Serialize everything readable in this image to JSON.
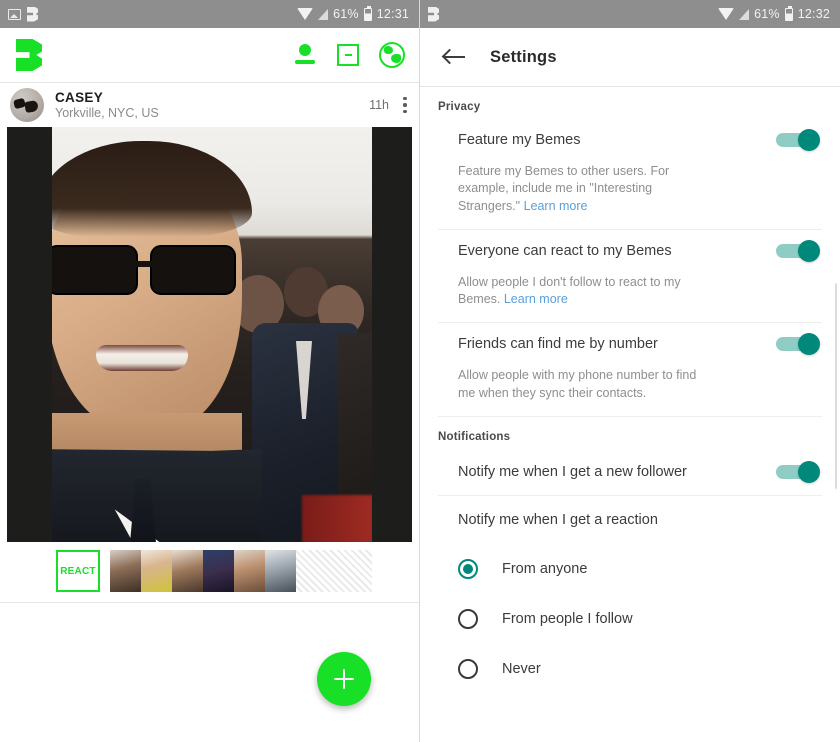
{
  "left": {
    "status_bar": {
      "icons": [
        "screenshot-icon",
        "beme-app-icon"
      ],
      "wifi_icon": "wifi-icon",
      "signal_icon": "cell-signal-icon",
      "battery_text": "61%",
      "battery_icon": "battery-icon",
      "time": "12:31"
    },
    "app_bar": {
      "logo": "beme-logo",
      "actions": [
        {
          "name": "profile-icon"
        },
        {
          "name": "square-dash-icon"
        },
        {
          "name": "globe-icon"
        }
      ]
    },
    "post": {
      "author": "CASEY",
      "location": "Yorkville, NYC, US",
      "time_ago": "11h",
      "menu_icon": "overflow-menu-icon",
      "avatar_icon": "sunglasses-avatar"
    },
    "react": {
      "button_label": "REACT",
      "thumb_count": 6
    },
    "fab": {
      "label": "+",
      "color": "#17e027"
    }
  },
  "right": {
    "status_bar": {
      "icons": [
        "beme-app-icon"
      ],
      "wifi_icon": "wifi-icon",
      "signal_icon": "cell-signal-icon",
      "battery_text": "61%",
      "battery_icon": "battery-icon",
      "time": "12:32"
    },
    "app_bar": {
      "back_icon": "back-arrow-icon",
      "title": "Settings"
    },
    "sections": [
      {
        "label": "Privacy",
        "items": [
          {
            "title": "Feature my Bemes",
            "desc": "Feature my Bemes to other users. For example, include me in \"Interesting Strangers.\" ",
            "link": "Learn more",
            "toggle": "on"
          },
          {
            "title": "Everyone can react to my Bemes",
            "desc": "Allow people I don't follow to react to my Bemes. ",
            "link": "Learn more",
            "toggle": "on"
          },
          {
            "title": "Friends can find me by number",
            "desc": "Allow people with my phone number to find me when they sync their contacts.",
            "link": "",
            "toggle": "on"
          }
        ]
      },
      {
        "label": "Notifications",
        "items": [
          {
            "title": "Notify me when I get a new follower",
            "desc": "",
            "link": "",
            "toggle": "on"
          },
          {
            "title": "Notify me when I get a reaction",
            "desc": "",
            "link": "",
            "toggle": "none"
          }
        ]
      }
    ],
    "radio_options": [
      {
        "label": "From anyone",
        "selected": true
      },
      {
        "label": "From people I follow",
        "selected": false
      },
      {
        "label": "Never",
        "selected": false
      }
    ],
    "accent_color": "#00897b"
  }
}
